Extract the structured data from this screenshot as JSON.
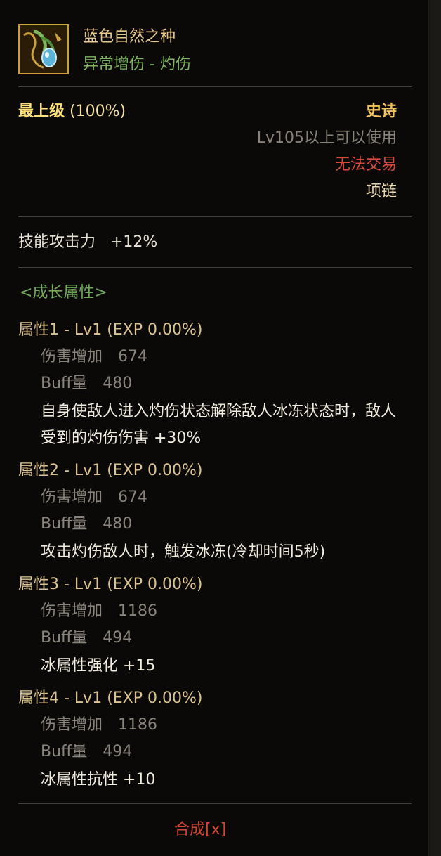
{
  "item": {
    "name": "蓝色自然之种",
    "subtype": "异常增伤 - 灼伤",
    "icon": "green-seed-necklace-icon"
  },
  "meta": {
    "grade_label": "最上级",
    "grade_percent": "(100%)",
    "rarity": "史诗",
    "level_requirement": "Lv105以上可以使用",
    "trade_status": "无法交易",
    "slot": "项链"
  },
  "base_stat": {
    "label": "技能攻击力",
    "value": "+12%"
  },
  "growth": {
    "header": "<成长属性>",
    "attributes": [
      {
        "title": "属性1 - Lv1 (EXP 0.00%)",
        "damage_label": "伤害增加",
        "damage_value": "674",
        "buff_label": "Buff量",
        "buff_value": "480",
        "effect": "自身使敌人进入灼伤状态解除敌人冰冻状态时，敌人受到的灼伤伤害 +30%"
      },
      {
        "title": "属性2 - Lv1 (EXP 0.00%)",
        "damage_label": "伤害增加",
        "damage_value": "674",
        "buff_label": "Buff量",
        "buff_value": "480",
        "effect": "攻击灼伤敌人时，触发冰冻(冷却时间5秒)"
      },
      {
        "title": "属性3 - Lv1 (EXP 0.00%)",
        "damage_label": "伤害增加",
        "damage_value": "1186",
        "buff_label": "Buff量",
        "buff_value": "494",
        "effect": "冰属性强化 +15"
      },
      {
        "title": "属性4 - Lv1 (EXP 0.00%)",
        "damage_label": "伤害增加",
        "damage_value": "1186",
        "buff_label": "Buff量",
        "buff_value": "494",
        "effect": "冰属性抗性 +10"
      }
    ]
  },
  "footer": {
    "compose_label": "合成[x]"
  },
  "colors": {
    "name": "#e7c98c",
    "subtype": "#7fb55f",
    "rarity": "#f1c35a",
    "untradeable": "#d84a3a",
    "compose": "#d04634"
  }
}
